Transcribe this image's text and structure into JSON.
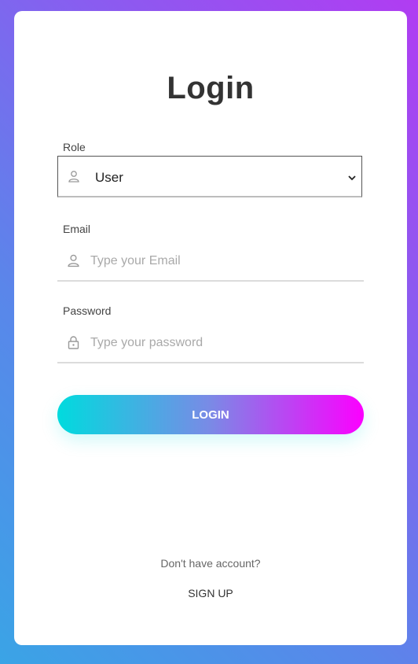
{
  "title": "Login",
  "role": {
    "label": "Role",
    "value": "User",
    "icon": "user-icon"
  },
  "email": {
    "label": "Email",
    "placeholder": "Type your Email",
    "value": "",
    "icon": "user-icon"
  },
  "password": {
    "label": "Password",
    "placeholder": "Type your password",
    "value": "",
    "icon": "lock-icon"
  },
  "login_button": {
    "label": "LOGIN"
  },
  "footer": {
    "prompt": "Don't have account?",
    "signup_link": "SIGN UP"
  },
  "colors": {
    "button_gradient_start": "#00dbde",
    "button_gradient_end": "#fc00ff",
    "background_start": "#b13cf2",
    "background_end": "#3aa4e6"
  }
}
